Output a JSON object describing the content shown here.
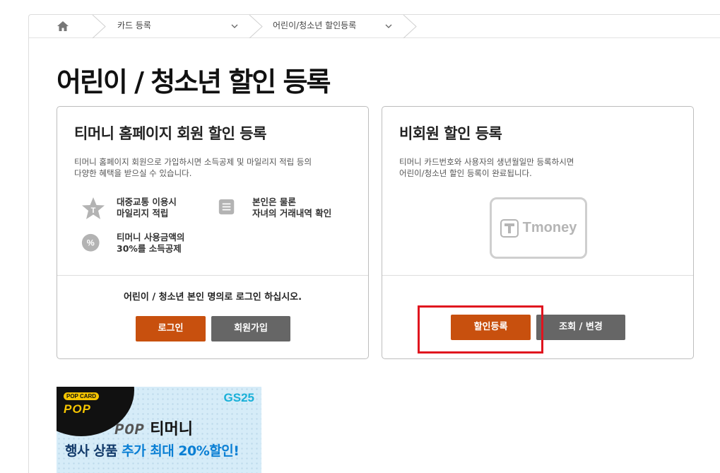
{
  "breadcrumb": {
    "items": [
      {
        "label": "카드 등록"
      },
      {
        "label": "어린이/청소년 할인등록"
      }
    ]
  },
  "page": {
    "title": "어린이 / 청소년 할인 등록"
  },
  "member_card": {
    "title": "티머니 홈페이지 회원 할인 등록",
    "desc_line1": "티머니 홈페이지 회원으로 가입하시면 소득공제 및 마일리지 적립 등의",
    "desc_line2": "다양한 혜택을 받으실 수 있습니다.",
    "features": [
      {
        "icon": "star-t-icon",
        "line1": "대중교통 이용시",
        "line2": "마일리지 적립"
      },
      {
        "icon": "document-list-icon",
        "line1": "본인은 물론",
        "line2": "자녀의 거래내역 확인"
      },
      {
        "icon": "percent-icon",
        "line1": "티머니 사용금액의",
        "line2": "30%를 소득공제"
      }
    ],
    "login_note": "어린이 / 청소년 본인 명의로 로그인 하십시오.",
    "login_label": "로그인",
    "join_label": "회원가입"
  },
  "nonmember_card": {
    "title": "비회원 할인 등록",
    "desc_line1": "티머니 카드번호와 사용자의 생년월일만 등록하시면",
    "desc_line2": "어린이/청소년 할인 등록이 완료됩니다.",
    "logo_text": "Tmoney",
    "register_label": "할인등록",
    "lookup_label": "조회 / 변경"
  },
  "banner": {
    "badge": "POP CARD",
    "pop_small": "POP",
    "brand": "GS25",
    "line1_pop": "POP",
    "line1_text": "티머니",
    "line2_prefix": "행사 상품 ",
    "line2_highlight": "추가 최대 20%할인!"
  },
  "colors": {
    "accent": "#c8500e",
    "secondary_button": "#666666",
    "highlight": "#e0141e"
  }
}
